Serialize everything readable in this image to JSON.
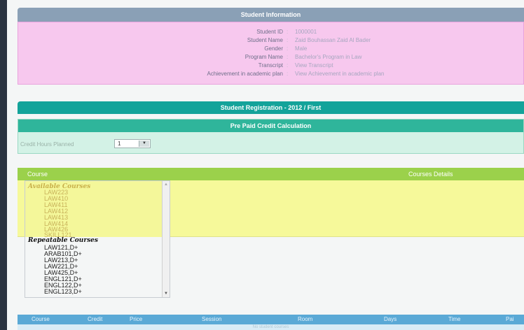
{
  "student_info": {
    "header": "Student Information",
    "rows": [
      {
        "label": "Student ID",
        "value": "1000001"
      },
      {
        "label": "Student Name",
        "value": "Zaid Bouhassan Zaid Al Bader"
      },
      {
        "label": "Gender",
        "value": "Male"
      },
      {
        "label": "Program Name",
        "value": "Bachelor's Program in Law"
      },
      {
        "label": "Transcript",
        "value": "View Transcript"
      },
      {
        "label": "Achievement in academic plan",
        "value": "View Achievement in academic plan"
      }
    ],
    "separator": ":"
  },
  "registration": {
    "header": "Student Registration - 2012 / First"
  },
  "prepaid": {
    "header": "Pre Paid Credit Calculation",
    "credit_label": "Credit Hours Planned",
    "credit_value": "1",
    "dropdown_arrow": "▼"
  },
  "courses": {
    "col_course": "Course",
    "col_details": "Courses Details",
    "available_title": "Available Courses",
    "available": [
      "LAW223",
      "LAW410",
      "LAW411",
      "LAW412",
      "LAW413",
      "LAW414",
      "LAW426",
      "SKILL121"
    ],
    "repeatable_title": "Repeatable Courses",
    "repeatable": [
      "LAW121,D+",
      "ARAB101,D+",
      "LAW213,D+",
      "LAW221,D+",
      "LAW425,D+",
      "ENGL121,D+",
      "ENGL122,D+",
      "ENGL123,D+"
    ]
  },
  "schedule": {
    "columns": [
      "Course",
      "Credit",
      "Price",
      "Session",
      "Room",
      "Days",
      "Time",
      "Pai"
    ],
    "empty_text": "No student courses"
  },
  "colors": {
    "info_bar": "#8aa0b6",
    "info_panel": "#f7c8ee",
    "registration_bar": "#13a39a",
    "prepaid_bar": "#2fb59b",
    "course_header": "#9bd14b",
    "available_band": "#f6f99a",
    "schedule_header": "#5aa9d6"
  }
}
